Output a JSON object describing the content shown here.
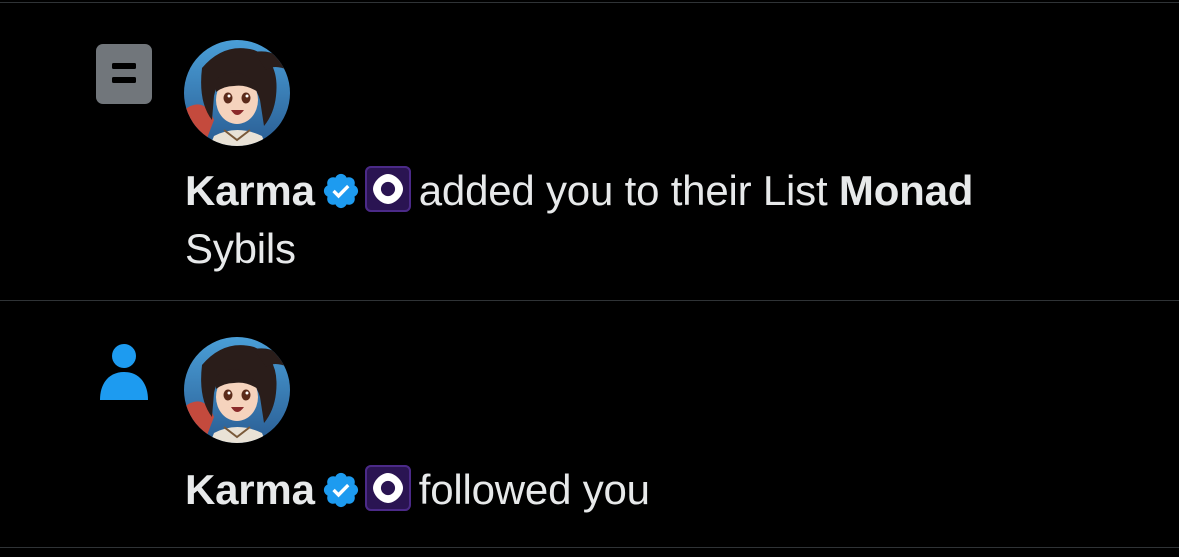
{
  "notifications": [
    {
      "type_icon": "list-icon",
      "avatar_icon": "anime-avatar",
      "user_name": "Karma",
      "verified_icon": "verified-badge-icon",
      "affiliation_icon": "monad-affiliate-icon",
      "action_text": "added you to their List",
      "list_name_line1": "Monad",
      "list_name_line2": "Sybils"
    },
    {
      "type_icon": "person-icon",
      "avatar_icon": "anime-avatar",
      "user_name": "Karma",
      "verified_icon": "verified-badge-icon",
      "affiliation_icon": "monad-affiliate-icon",
      "action_text": "followed you"
    }
  ],
  "colors": {
    "background": "#000000",
    "text": "#e7e9ea",
    "divider": "#2f3336",
    "verified": "#1d9bf0",
    "follow_icon": "#1d9bf0",
    "list_icon_bg": "#71767b",
    "monad_purple": "#3b1d6e"
  }
}
